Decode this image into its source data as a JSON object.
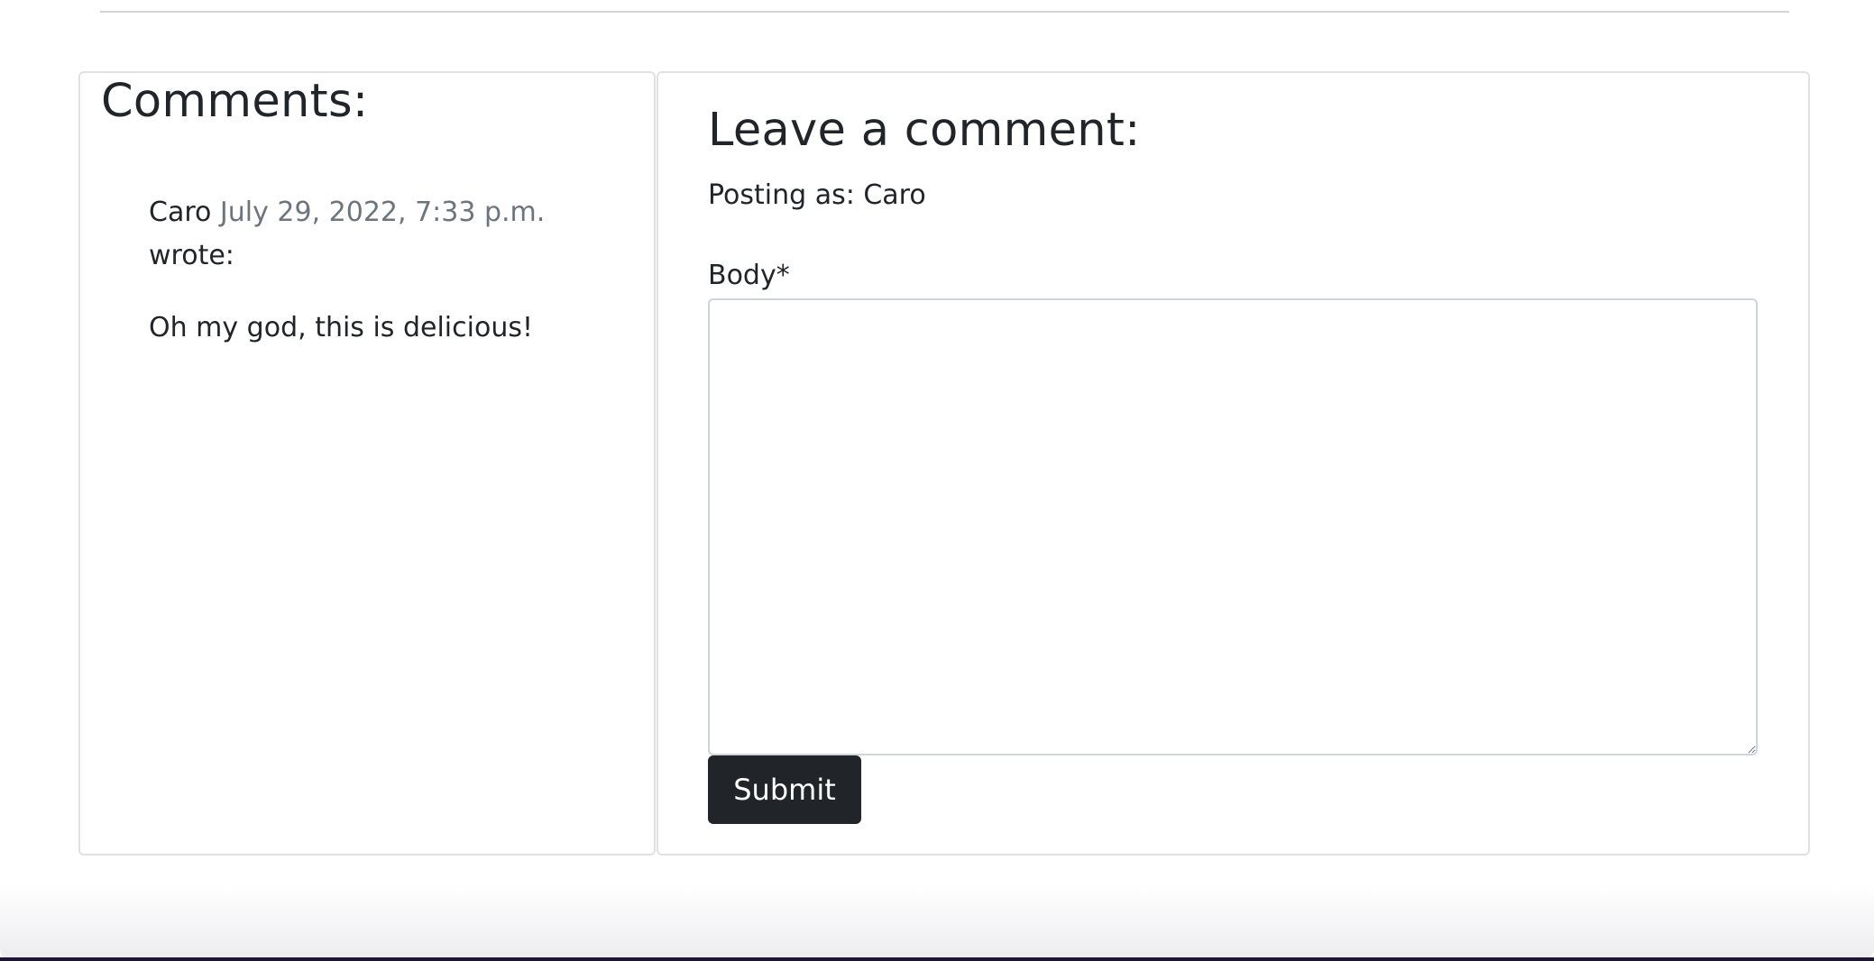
{
  "comments": {
    "title": "Comments:",
    "items": [
      {
        "author": "Caro",
        "date": "July 29, 2022, 7:33 p.m.",
        "wrote_label": "wrote:",
        "body": "Oh my god, this is delicious!"
      }
    ]
  },
  "comment_form": {
    "title": "Leave a comment:",
    "posting_as": "Posting as: Caro",
    "body_label": "Body*",
    "body_value": "",
    "submit_label": "Submit"
  },
  "colors": {
    "text": "#212529",
    "muted_date": "#6c757d",
    "button_bg": "#212529",
    "button_text": "#ffffff",
    "card_border": "#dfe1e4"
  }
}
